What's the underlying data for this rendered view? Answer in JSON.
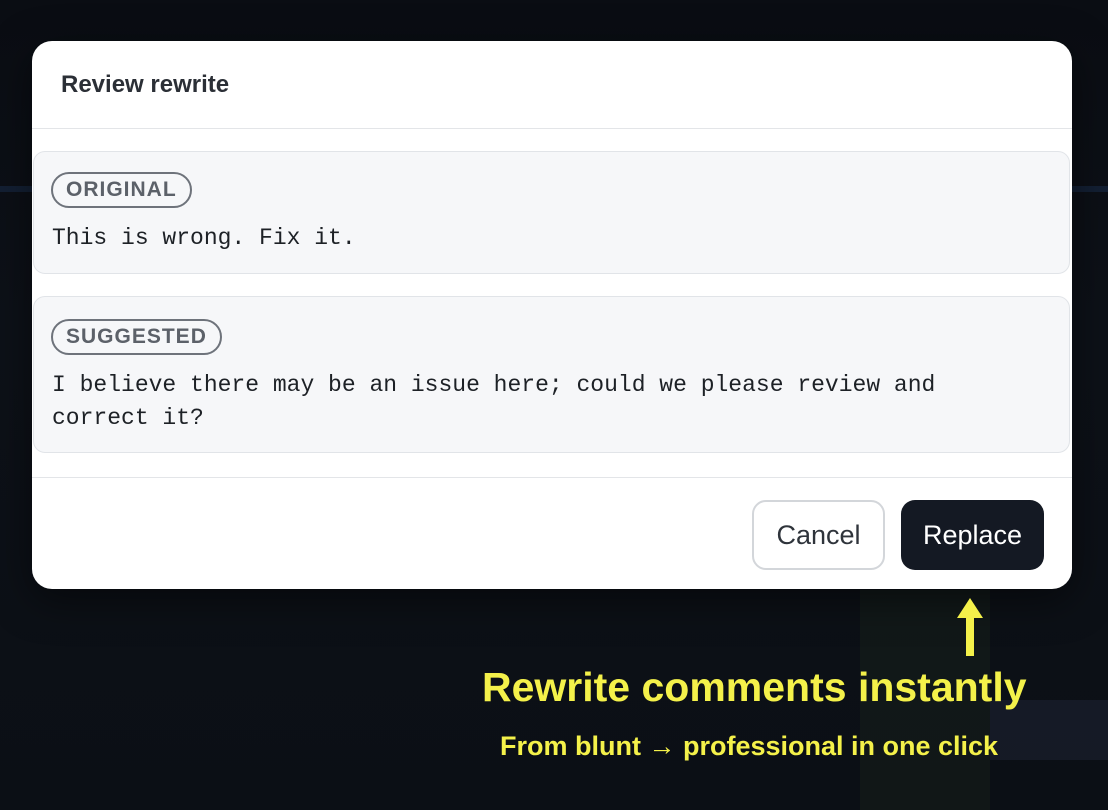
{
  "modal": {
    "title": "Review rewrite",
    "original": {
      "badge": "ORIGINAL",
      "text": "This is wrong. Fix it."
    },
    "suggested": {
      "badge": "SUGGESTED",
      "text": "I believe there may be an issue here; could we please review and correct it?"
    },
    "buttons": {
      "cancel_label": "Cancel",
      "replace_label": "Replace"
    }
  },
  "annotation": {
    "headline": "Rewrite comments instantly",
    "subline": "From blunt → professional in one click",
    "arrow_icon": "arrow-up-icon",
    "color": "#f4f14a"
  },
  "colors": {
    "primary_button": "#141923",
    "card_background": "#f6f7f9",
    "badge_border": "#6e737b"
  }
}
